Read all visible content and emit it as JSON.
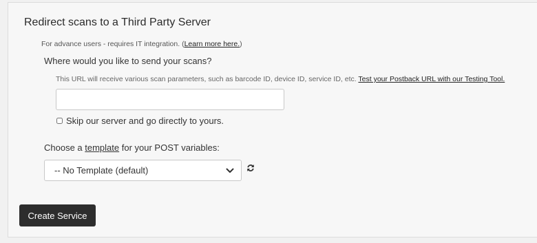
{
  "section": {
    "title": "Redirect scans to a Third Party Server",
    "advance_prefix": "For advance users - requires IT integration. (",
    "advance_link": "Learn more here.",
    "advance_suffix": ")"
  },
  "postback": {
    "question": "Where would you like to send your scans?",
    "note": "This URL will receive various scan parameters, such as barcode ID, device ID, service ID, etc. ",
    "test_link": "Test your Postback URL with our Testing Tool.",
    "url_value": "",
    "skip_label": "Skip our server and go directly to yours.",
    "skip_checked": false
  },
  "template": {
    "label_prefix": "Choose a ",
    "label_link": "template",
    "label_suffix": " for your POST variables:",
    "selected": "-- No Template (default)",
    "chevron_icon": "chevron-down-icon",
    "refresh_icon": "refresh-icon"
  },
  "actions": {
    "create_label": "Create Service"
  },
  "colors": {
    "button_bg": "#2d2d2d",
    "panel_bg": "#f7f7f7"
  }
}
